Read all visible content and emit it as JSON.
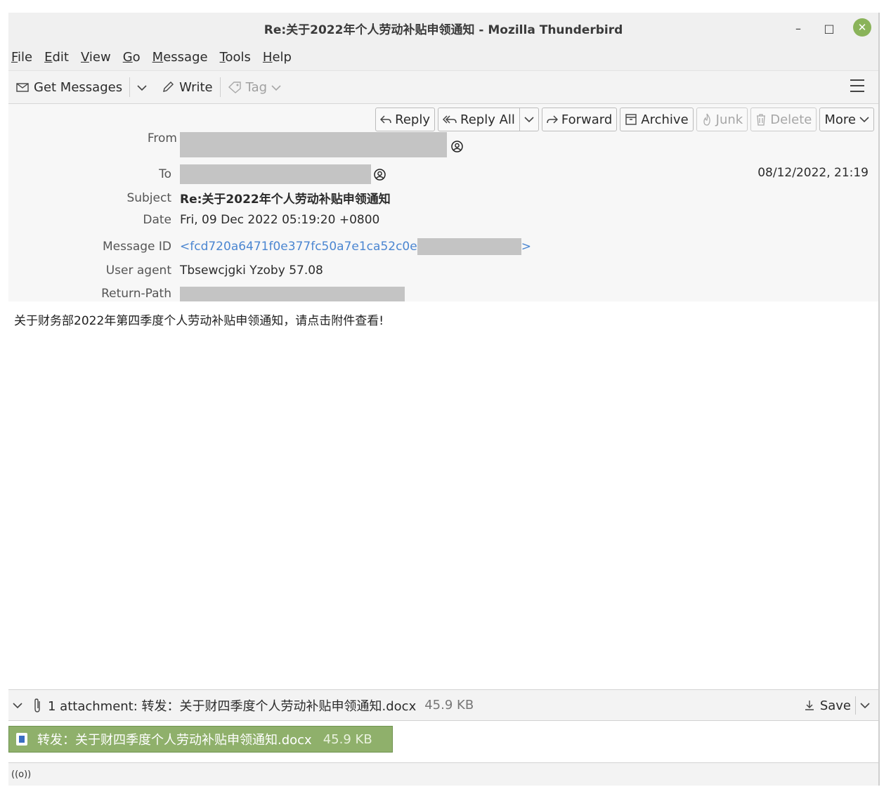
{
  "window": {
    "title": "Re:关于2022年个人劳动补贴申领通知 - Mozilla Thunderbird",
    "minimize": "–",
    "maximize": "□",
    "close": "✕"
  },
  "menubar": {
    "items": [
      {
        "key": "F",
        "rest": "ile"
      },
      {
        "key": "E",
        "rest": "dit"
      },
      {
        "key": "V",
        "rest": "iew"
      },
      {
        "key": "G",
        "rest": "o"
      },
      {
        "key": "M",
        "rest": "essage"
      },
      {
        "key": "T",
        "rest": "ools"
      },
      {
        "key": "H",
        "rest": "elp"
      }
    ]
  },
  "toolbar": {
    "get_messages": "Get Messages",
    "write": "Write",
    "tag": "Tag"
  },
  "actions": {
    "reply": "Reply",
    "reply_all": "Reply All",
    "forward": "Forward",
    "archive": "Archive",
    "junk": "Junk",
    "delete": "Delete",
    "more": "More"
  },
  "headers": {
    "from_label": "From",
    "to_label": "To",
    "subject_label": "Subject",
    "subject": "Re:关于2022年个人劳动补贴申领通知",
    "date_label": "Date",
    "date": "Fri, 09 Dec 2022 05:19:20 +0800",
    "message_id_label": "Message ID",
    "message_id": "<fcd720a6471f0e377fc50a7e1ca52c0e",
    "message_id_end": ">",
    "user_agent_label": "User agent",
    "user_agent": "Tbsewcjgki Yzoby 57.08",
    "return_path_label": "Return-Path",
    "received": "08/12/2022, 21:19"
  },
  "body": {
    "text": "关于财务部2022年第四季度个人劳动补贴申领通知，请点击附件查看!"
  },
  "attachments": {
    "summary": "1 attachment: 转发：关于财四季度个人劳动补贴申领通知.docx",
    "summary_size": "45.9 KB",
    "save": "Save",
    "item_name": "转发：关于财四季度个人劳动补贴申领通知.docx",
    "item_size": "45.9 KB"
  },
  "status": {
    "indicator": "((o))"
  }
}
